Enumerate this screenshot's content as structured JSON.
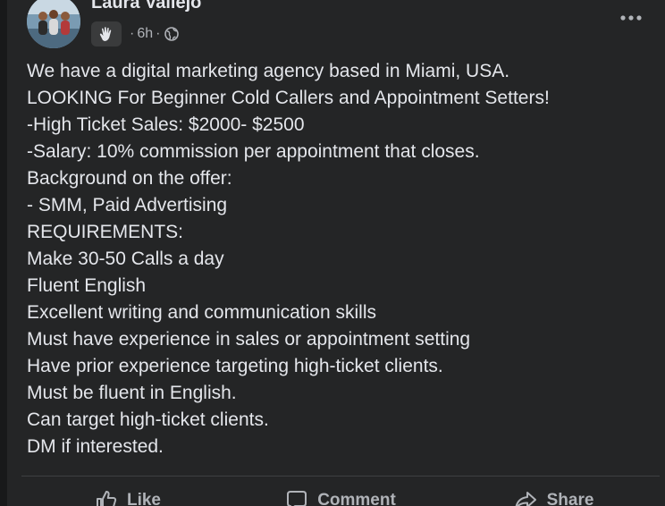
{
  "author": {
    "name": "Laura Vallejo",
    "time": "6h",
    "badge_icon": "waving-hand-icon",
    "audience_icon": "globe-icon",
    "meta_separator": "·"
  },
  "post": {
    "lines": [
      "We have a digital marketing agency based in Miami, USA.",
      "LOOKING For Beginner Cold Callers and Appointment Setters!",
      "-High Ticket Sales: $2000- $2500",
      "-Salary: 10% commission per appointment that closes.",
      "Background on the offer:",
      "- SMM,  Paid Advertising",
      "REQUIREMENTS:",
      "Make 30-50 Calls a day",
      "Fluent English",
      "Excellent writing and communication skills",
      "Must have experience in sales or appointment setting",
      "Have prior experience targeting high-ticket clients.",
      "Must be fluent in English.",
      "Can target high-ticket clients.",
      "DM if interested."
    ]
  },
  "actions": {
    "like": "Like",
    "comment": "Comment",
    "share": "Share"
  },
  "colors": {
    "page_background": "#18191a",
    "card_background": "#242526",
    "primary_text": "#e4e6eb",
    "secondary_text": "#b0b3b8",
    "divider": "#3e4042",
    "badge_background": "#3a3b3c"
  }
}
